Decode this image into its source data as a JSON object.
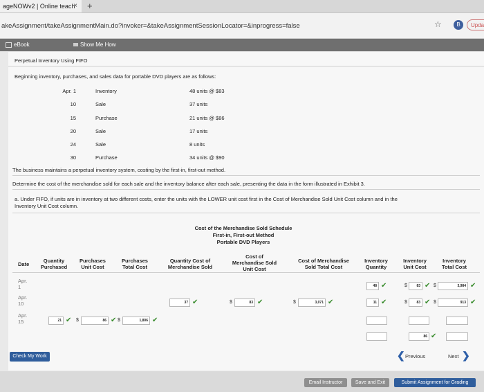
{
  "browser": {
    "tab_title": "ageNOWv2 | Online teach",
    "tab_close": "×",
    "new_tab": "+",
    "url": "akeAssignment/takeAssignmentMain.do?invoker=&takeAssignmentSessionLocator=&inprogress=false",
    "star": "☆",
    "profile_badge": "B",
    "update_label": "Upda"
  },
  "toolbar": {
    "ebook": "eBook",
    "show_me_how": "Show Me How"
  },
  "problem": {
    "title": "Perpetual Inventory Using FIFO",
    "intro": "Beginning inventory, purchases, and sales data for portable DVD players are as follows:",
    "transactions": [
      {
        "date": "Apr. 1",
        "type": "Inventory",
        "detail": "48 units @ $83"
      },
      {
        "date": "10",
        "type": "Sale",
        "detail": "37 units"
      },
      {
        "date": "15",
        "type": "Purchase",
        "detail": "21 units @ $86"
      },
      {
        "date": "20",
        "type": "Sale",
        "detail": "17 units"
      },
      {
        "date": "24",
        "type": "Sale",
        "detail": "8 units"
      },
      {
        "date": "30",
        "type": "Purchase",
        "detail": "34 units @ $90"
      }
    ],
    "method_text": "The business maintains a perpetual inventory system, costing by the first-in, first-out method.",
    "determine_text": "Determine the cost of the merchandise sold for each sale and the inventory balance after each sale, presenting the data in the form illustrated in Exhibit 3.",
    "part_a_line1": "a.  Under FIFO, if units are in inventory at two different costs, enter the units with the LOWER unit cost first in the Cost of Merchandise Sold Unit Cost column and in the",
    "part_a_line2": "Inventory Unit Cost column."
  },
  "schedule": {
    "title_lines": [
      "Cost of the Merchandise Sold Schedule",
      "First-in, First-out Method",
      "Portable DVD Players"
    ],
    "headers": {
      "date": "Date",
      "qty_purchased": [
        "Quantity",
        "Purchased"
      ],
      "purch_unit_cost": [
        "Purchases",
        "Unit Cost"
      ],
      "purch_total_cost": [
        "Purchases",
        "Total Cost"
      ],
      "qty_cost_sold": [
        "Quantity Cost of",
        "Merchandise Sold"
      ],
      "cms_unit_cost": [
        "Cost of",
        "Merchandise Sold",
        "Unit Cost"
      ],
      "cms_total_cost": [
        "Cost of Merchandise",
        "Sold Total Cost"
      ],
      "inv_quantity": [
        "Inventory",
        "Quantity"
      ],
      "inv_unit_cost": [
        "Inventory",
        "Unit Cost"
      ],
      "inv_total_cost": [
        "Inventory",
        "Total Cost"
      ]
    },
    "rows": [
      {
        "date": [
          "Apr.",
          "1"
        ],
        "inv_quantity": "48",
        "inv_unit_cost": "83",
        "inv_total_cost": "3,984"
      },
      {
        "date": [
          "Apr.",
          "10"
        ],
        "qty_cost_sold": "37",
        "cms_unit_cost": "83",
        "cms_total_cost": "3,071",
        "inv_quantity": "11",
        "inv_unit_cost": "83",
        "inv_total_cost": "913"
      },
      {
        "date": [
          "Apr.",
          "15"
        ],
        "qty_purchased": "21",
        "purch_unit_cost": "86",
        "purch_total_cost": "1,806",
        "inv_quantity": "",
        "inv_unit_cost": "",
        "inv_total_cost": ""
      },
      {
        "extra": true,
        "inv_quantity": "",
        "inv_unit_cost": "86",
        "inv_total_cost": ""
      }
    ],
    "dollar": "$",
    "check": "✔"
  },
  "buttons": {
    "check_my_work": "Check My Work",
    "previous": "Previous",
    "next": "Next",
    "email_instructor": "Email Instructor",
    "save_and_exit": "Save and Exit",
    "submit": "Submit Assignment for Grading"
  },
  "colors": {
    "check_green": "#3b8d2f",
    "blue_button": "#2f5d9c",
    "nav_arrow": "#2e5fa8"
  }
}
